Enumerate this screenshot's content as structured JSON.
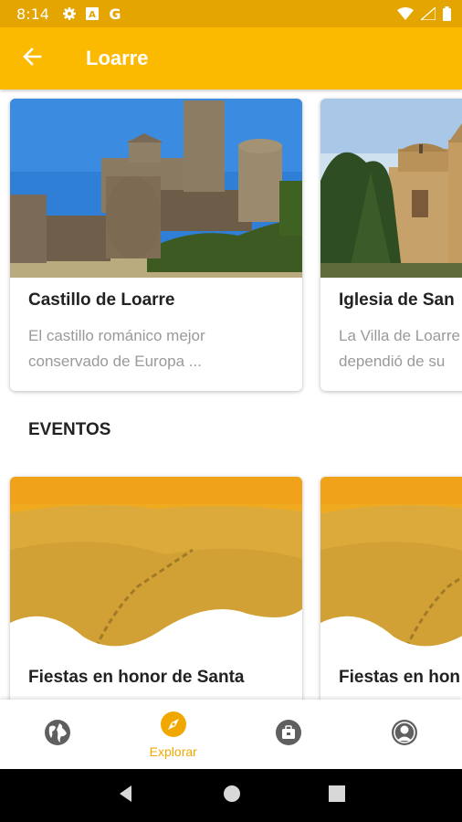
{
  "status_bar": {
    "time": "8:14",
    "left_icons": [
      "gear-icon",
      "a-box-icon",
      "google-g-icon"
    ],
    "right_icons": [
      "wifi-icon",
      "signal-icon",
      "battery-icon"
    ]
  },
  "app_bar": {
    "title": "Loarre",
    "back_icon": "arrow-left-icon",
    "color": "#fbb900"
  },
  "places": [
    {
      "title": "Castillo de Loarre",
      "desc_line1": "El castillo románico mejor",
      "desc_line2": "conservado de Europa ..."
    },
    {
      "title": "Iglesia de San",
      "desc_line1": "La Villa de Loarre",
      "desc_line2": "dependió de su"
    }
  ],
  "section": {
    "events_title": "EVENTOS"
  },
  "events": [
    {
      "title": "Fiestas en honor de Santa"
    },
    {
      "title": "Fiestas en hon"
    }
  ],
  "bottom_nav": {
    "items": [
      {
        "icon": "globe-icon",
        "label": ""
      },
      {
        "icon": "compass-icon",
        "label": "Explorar",
        "active": true
      },
      {
        "icon": "briefcase-icon",
        "label": ""
      },
      {
        "icon": "account-icon",
        "label": ""
      }
    ],
    "active_color": "#f0a800"
  },
  "system_nav": {
    "icons": [
      "back-triangle-icon",
      "home-circle-icon",
      "recents-square-icon"
    ]
  }
}
